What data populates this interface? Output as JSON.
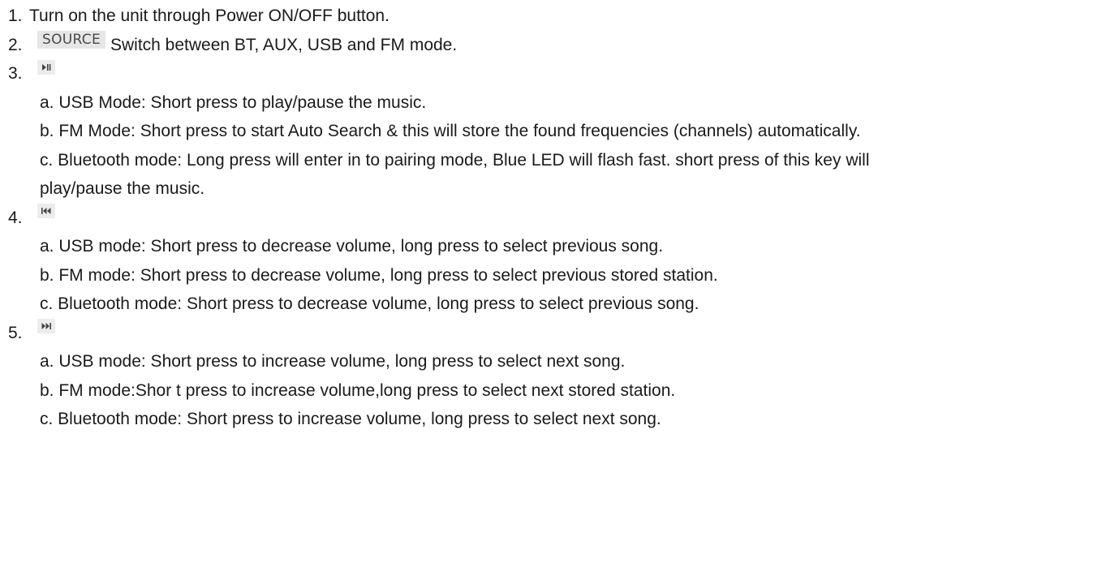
{
  "items": [
    {
      "number": "1.",
      "text": "Turn on the unit through Power ON/OFF button."
    },
    {
      "number": "2.",
      "button_label": "SOURCE",
      "text": "Switch between BT, AUX, USB and FM mode."
    },
    {
      "number": "3.",
      "icon": "play-pause-icon",
      "subitems": [
        "a. USB Mode: Short press to play/pause the music.",
        "b. FM Mode: Short press to start Auto Search & this will store the found frequencies (channels) automatically.",
        "c. Bluetooth mode: Long press will enter in to pairing mode, Blue LED will flash fast. short press of this key will",
        "play/pause the music."
      ]
    },
    {
      "number": "4.",
      "icon": "skip-previous-icon",
      "subitems": [
        "a. USB mode: Short press to decrease volume, long press to select previous song.",
        "b. FM mode: Short press to decrease volume, long press to select previous stored station.",
        "c. Bluetooth mode: Short press to decrease volume, long press to select previous song."
      ]
    },
    {
      "number": "5.",
      "icon": "skip-next-icon",
      "subitems": [
        "a. USB mode: Short press to increase volume, long press to select next song.",
        "b. FM mode:Shor t press to increase volume,long press to select next stored station.",
        "c. Bluetooth mode: Short press to increase volume, long press to select next song."
      ]
    }
  ],
  "colors": {
    "text": "#1a1a1a",
    "icon_background": "#e6e6e6",
    "icon_glyph": "#555555"
  }
}
